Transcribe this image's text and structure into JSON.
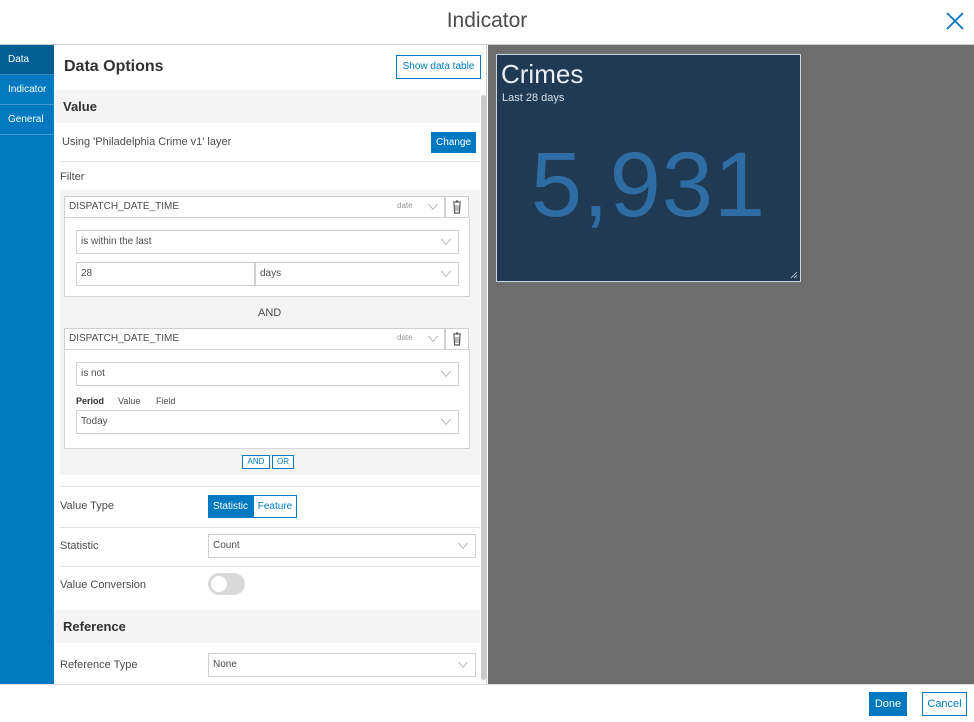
{
  "dialog": {
    "title": "Indicator"
  },
  "sidenav": {
    "items": [
      {
        "label": "Data"
      },
      {
        "label": "Indicator"
      },
      {
        "label": "General"
      }
    ]
  },
  "panel": {
    "title": "Data Options",
    "show_table_label": "Show data table",
    "value_section": "Value",
    "layer_text": "Using 'Philadelphia Crime v1' layer",
    "change_label": "Change",
    "filter_label": "Filter",
    "filters": [
      {
        "field": "DISPATCH_DATE_TIME",
        "type": "date",
        "operator": "is within the last",
        "number": "28",
        "unit": "days"
      },
      {
        "field": "DISPATCH_DATE_TIME",
        "type": "date",
        "operator": "is not",
        "tabs": [
          "Period",
          "Value",
          "Field"
        ],
        "period": "Today"
      }
    ],
    "and_joiner": "AND",
    "add_and": "AND",
    "add_or": "OR",
    "value_type_label": "Value Type",
    "value_type_options": [
      "Statistic",
      "Feature"
    ],
    "statistic_label": "Statistic",
    "statistic_value": "Count",
    "conversion_label": "Value Conversion",
    "conversion_on": false,
    "reference_section": "Reference",
    "reference_type_label": "Reference Type",
    "reference_type_value": "None"
  },
  "preview": {
    "title": "Crimes",
    "subtitle": "Last 28 days",
    "value": "5,931"
  },
  "footer": {
    "done_label": "Done",
    "cancel_label": "Cancel"
  },
  "colors": {
    "accent": "#0079c1",
    "card_bg": "#203a53",
    "value_color": "#2e6ca4",
    "preview_bg": "#6e6e6e"
  },
  "icons": {
    "close": "close-icon",
    "trash": "trash-icon",
    "chevron": "chevron-down-icon",
    "resize": "resize-handle-icon"
  }
}
